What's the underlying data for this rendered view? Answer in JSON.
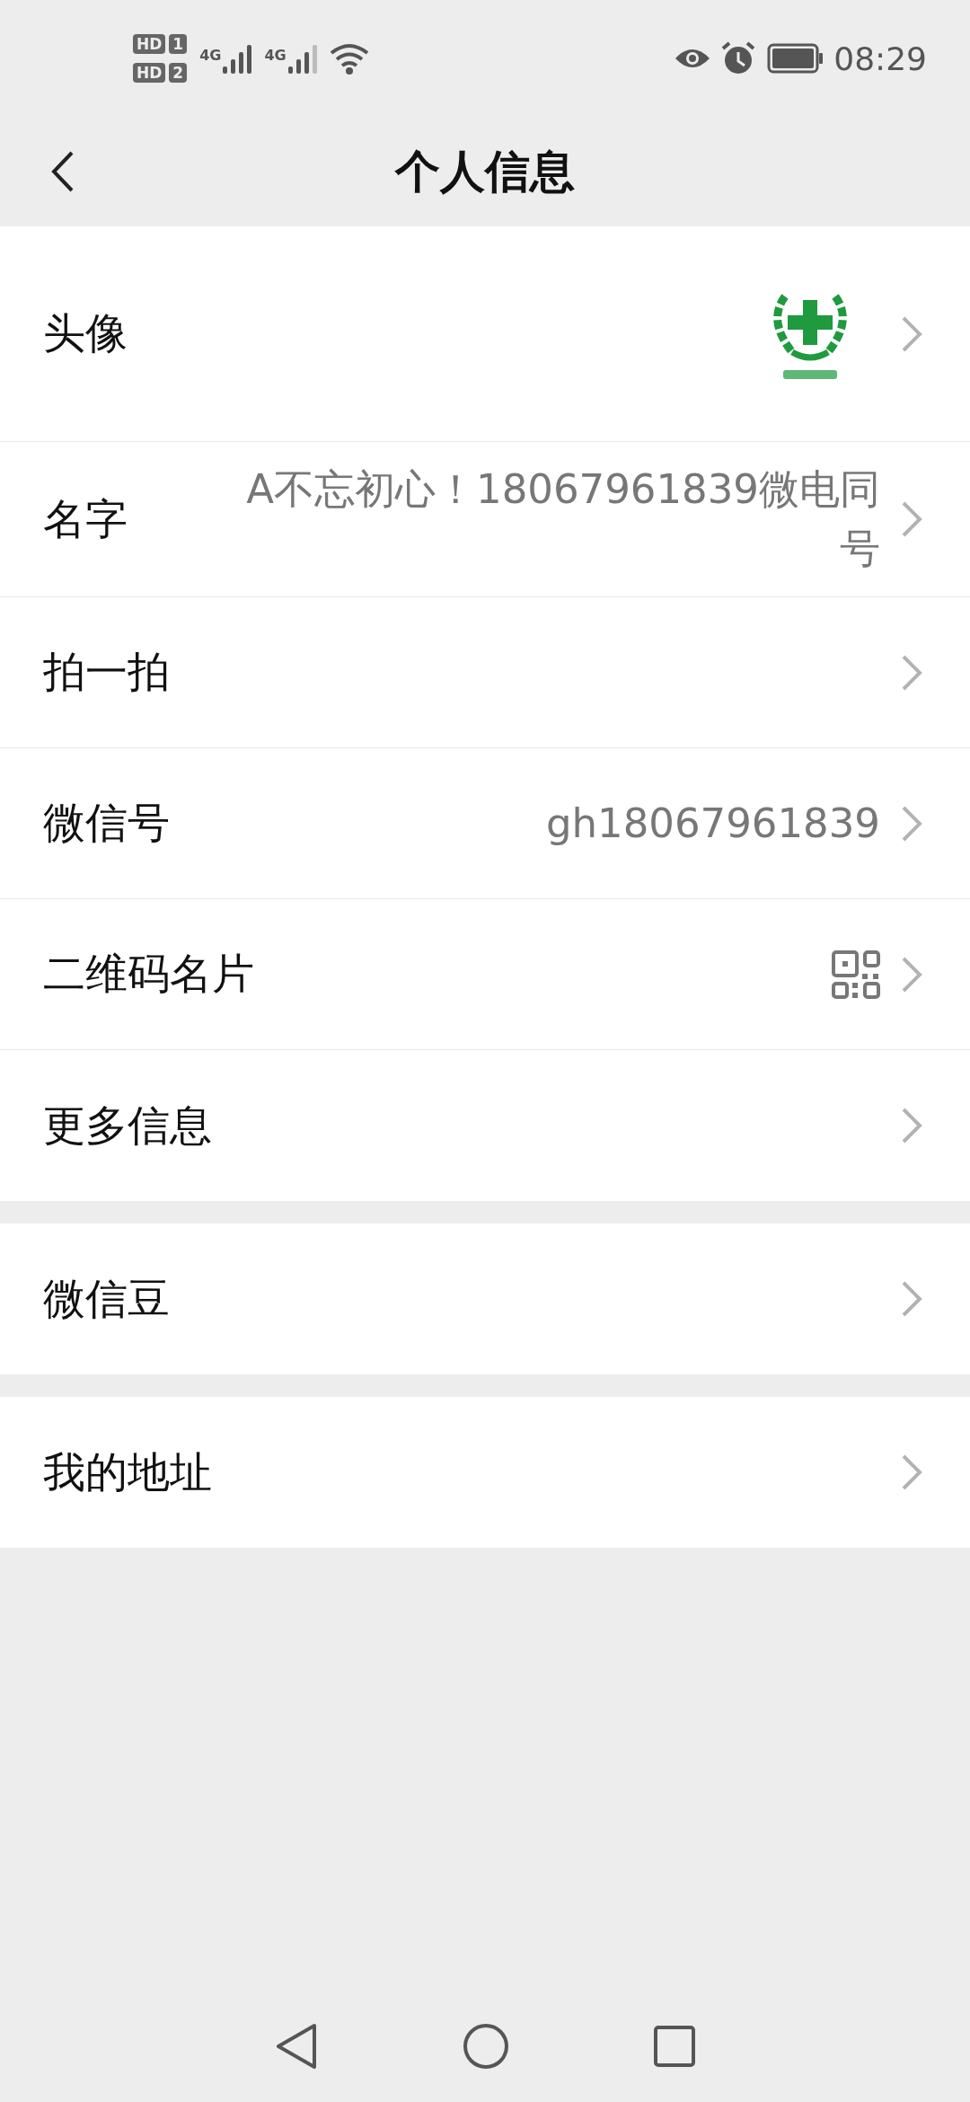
{
  "status_bar": {
    "sim_labels": [
      {
        "label": "HD",
        "slot": "1"
      },
      {
        "label": "HD",
        "slot": "2"
      }
    ],
    "network_labels": [
      "4G",
      "4G"
    ],
    "time": "08:29"
  },
  "nav": {
    "title": "个人信息"
  },
  "groups": [
    {
      "rows": [
        {
          "kind": "avatar",
          "label": "头像"
        },
        {
          "kind": "text",
          "label": "名字",
          "value": "A不忘初心！18067961839微电同号"
        },
        {
          "kind": "plain",
          "label": "拍一拍"
        },
        {
          "kind": "text",
          "label": "微信号",
          "value": "gh18067961839"
        },
        {
          "kind": "qr",
          "label": "二维码名片"
        },
        {
          "kind": "plain",
          "label": "更多信息"
        }
      ]
    },
    {
      "rows": [
        {
          "kind": "plain",
          "label": "微信豆"
        }
      ]
    },
    {
      "rows": [
        {
          "kind": "plain",
          "label": "我的地址"
        }
      ]
    }
  ]
}
